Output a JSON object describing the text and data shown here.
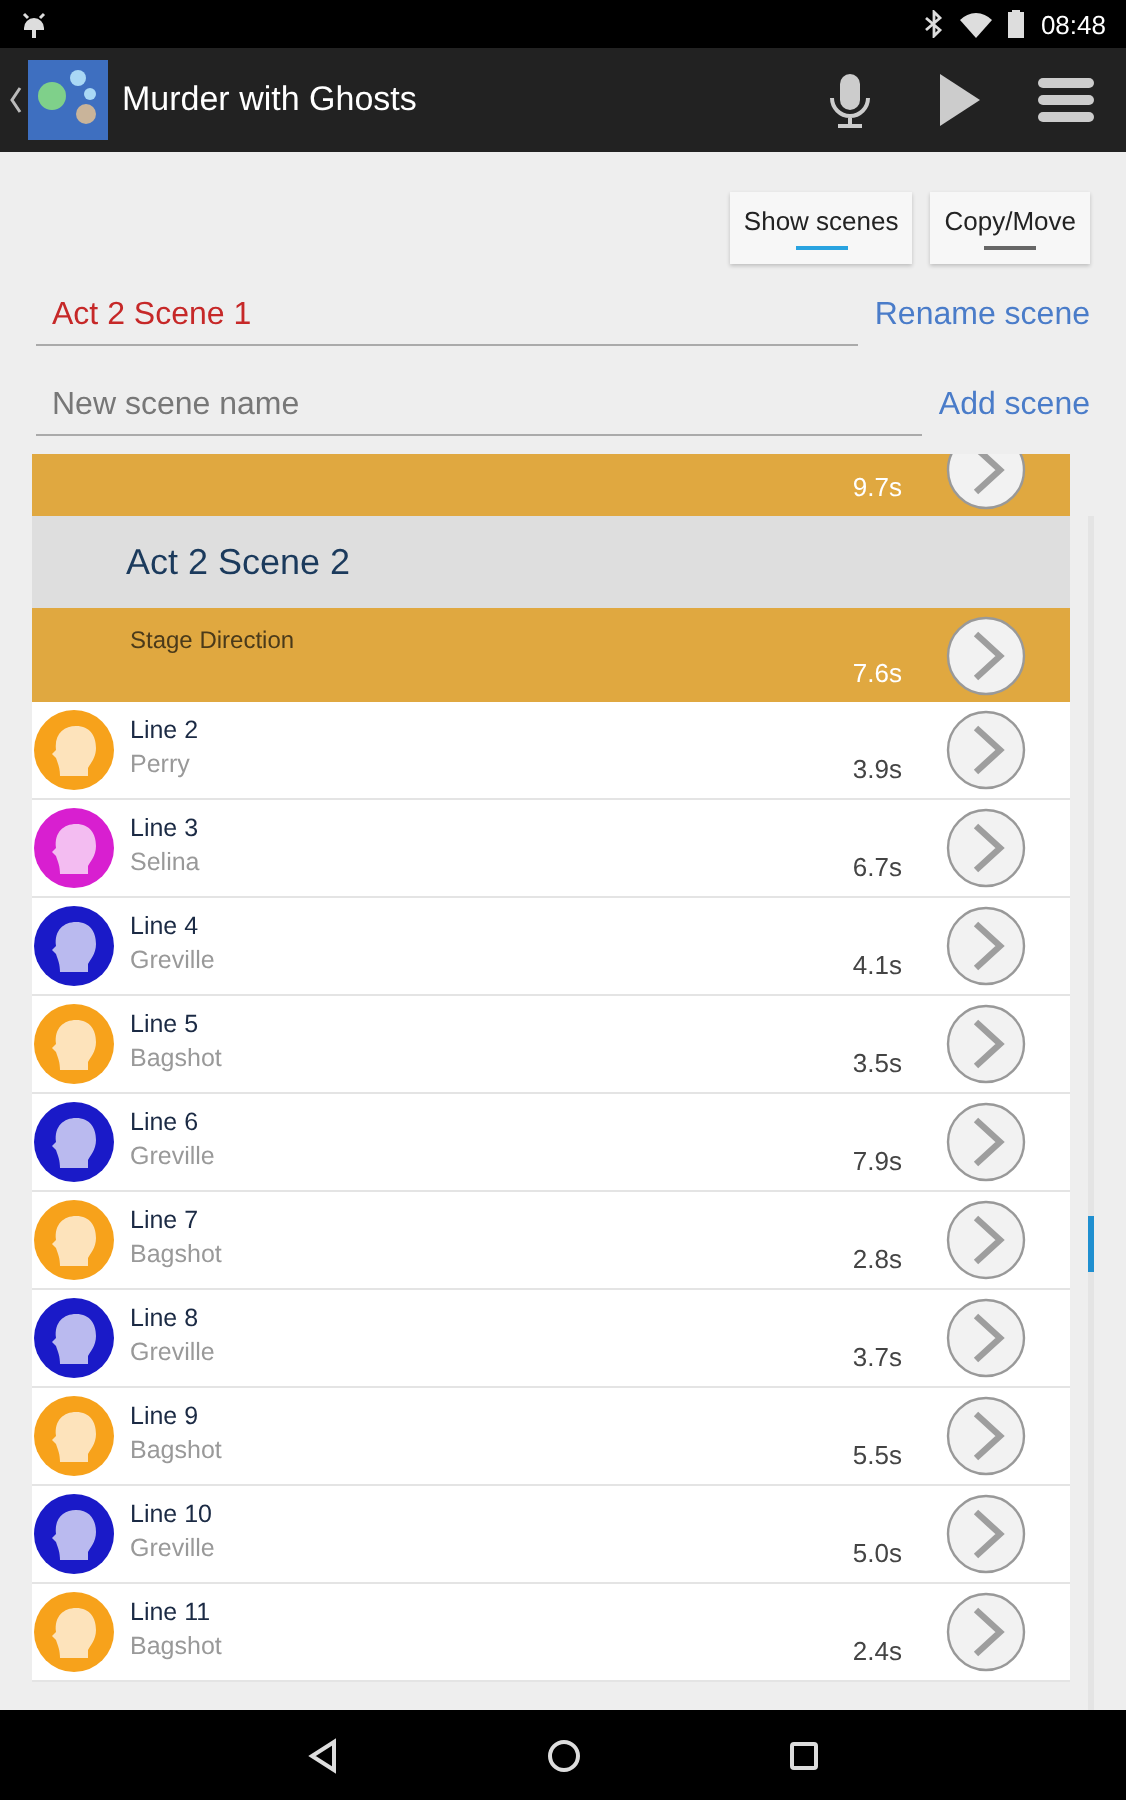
{
  "status_bar": {
    "time": "08:48"
  },
  "app_bar": {
    "title": "Murder with Ghosts"
  },
  "toggles": [
    {
      "label": "Show scenes",
      "selected": true
    },
    {
      "label": "Copy/Move",
      "selected": false
    }
  ],
  "rename": {
    "value": "Act 2 Scene 1",
    "action": "Rename scene"
  },
  "add": {
    "placeholder": "New scene name",
    "action": "Add scene"
  },
  "rows": [
    {
      "kind": "direction",
      "duration": "9.7s"
    },
    {
      "kind": "scene",
      "title": "Act 2 Scene 2"
    },
    {
      "kind": "direction",
      "label": "Stage Direction",
      "duration": "7.6s"
    },
    {
      "kind": "line",
      "title": "Line 2",
      "speaker": "Perry",
      "duration": "3.9s",
      "color": "#f7a21b"
    },
    {
      "kind": "line",
      "title": "Line 3",
      "speaker": "Selina",
      "duration": "6.7s",
      "color": "#d81fd0"
    },
    {
      "kind": "line",
      "title": "Line 4",
      "speaker": "Greville",
      "duration": "4.1s",
      "color": "#1a1ac8"
    },
    {
      "kind": "line",
      "title": "Line 5",
      "speaker": "Bagshot",
      "duration": "3.5s",
      "color": "#f7a21b"
    },
    {
      "kind": "line",
      "title": "Line 6",
      "speaker": "Greville",
      "duration": "7.9s",
      "color": "#1a1ac8"
    },
    {
      "kind": "line",
      "title": "Line 7",
      "speaker": "Bagshot",
      "duration": "2.8s",
      "color": "#f7a21b"
    },
    {
      "kind": "line",
      "title": "Line 8",
      "speaker": "Greville",
      "duration": "3.7s",
      "color": "#1a1ac8"
    },
    {
      "kind": "line",
      "title": "Line 9",
      "speaker": "Bagshot",
      "duration": "5.5s",
      "color": "#f7a21b"
    },
    {
      "kind": "line",
      "title": "Line 10",
      "speaker": "Greville",
      "duration": "5.0s",
      "color": "#1a1ac8"
    },
    {
      "kind": "line",
      "title": "Line 11",
      "speaker": "Bagshot",
      "duration": "2.4s",
      "color": "#f7a21b"
    }
  ]
}
